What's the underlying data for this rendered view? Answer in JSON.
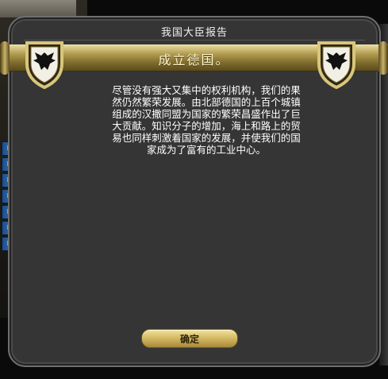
{
  "dialog": {
    "title": "我国大臣报告",
    "headline": "成立德国。",
    "body": "尽管没有强大又集中的权利机构，我们的果然仍然繁荣发展。由北部德国的上百个城镇组成的汉撒同盟为国家的繁荣昌盛作出了巨大贡献。知识分子的增加，海上和路上的贸易也同样刺激着国家的发展，并使我们的国家成为了富有的工业中心。",
    "ok_label": "确定"
  },
  "icons": {
    "shield_left": "eagle-shield-icon",
    "shield_right": "eagle-shield-icon"
  },
  "colors": {
    "dialog_bg": "#353535",
    "banner_gold": "#b09a4e",
    "button_gold": "#d5bc66",
    "text": "#ffffff"
  }
}
